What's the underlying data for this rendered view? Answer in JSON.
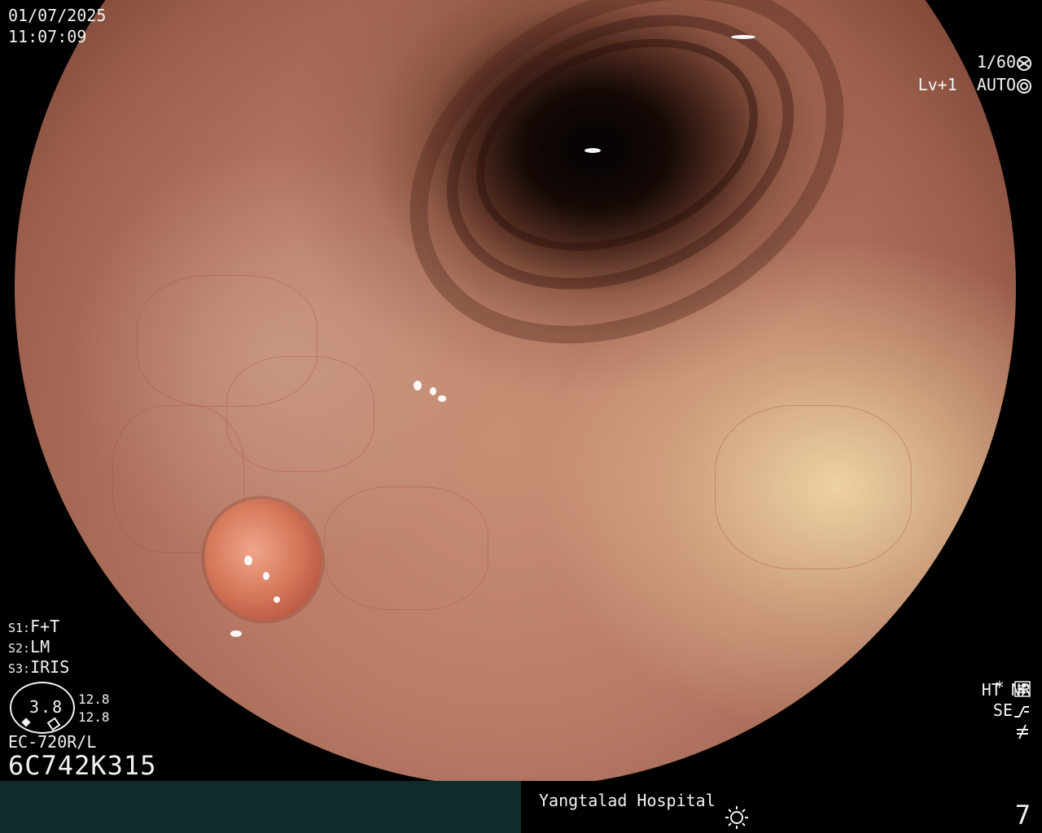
{
  "header": {
    "date": "01/07/2025",
    "time": "11:07:09"
  },
  "camera": {
    "shutter": "1/60",
    "shutter_icon": "aperture-icon",
    "level": "Lv+1",
    "mode": "AUTO",
    "mode_icon": "auto-iris-icon"
  },
  "scope_settings": {
    "s1_label": "S1:",
    "s1_value": "F+T",
    "s2_label": "S2:",
    "s2_value": "LM",
    "s3_label": "S3:",
    "s3_value": "IRIS"
  },
  "gauge": {
    "value": "3.8",
    "right_top": "12.8",
    "right_bottom": "12.8"
  },
  "device": {
    "model": "EC-720R/L",
    "serial": "6C742K315"
  },
  "right_status": {
    "star": "*",
    "star_icon": "settings-sliders-icon",
    "ht": "HT",
    "nr": "NR",
    "se": "SE",
    "se_icon": "curve-icon",
    "bottom_icon": "not-equal-icon",
    "accent_color": "#f0a020"
  },
  "footer": {
    "hospital": "Yangtalad Hospital",
    "light_icon": "sun-icon",
    "image_count": "7",
    "left_panel_color": "#0f2b2b"
  }
}
